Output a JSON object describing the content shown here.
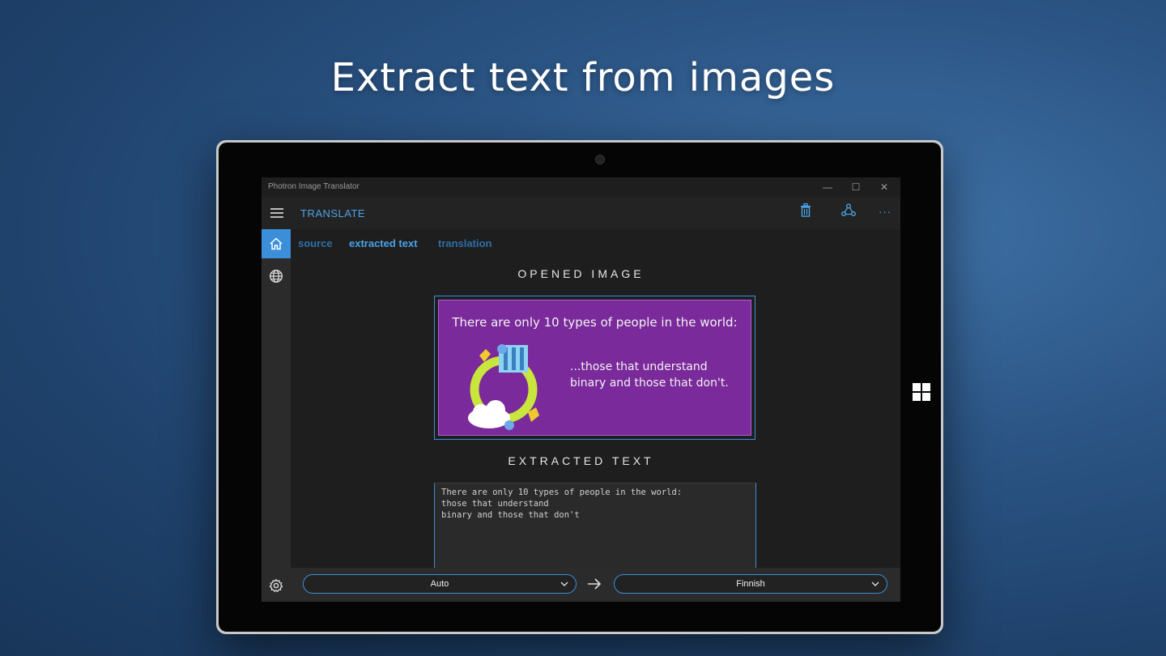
{
  "headline": "Extract text from images",
  "window": {
    "title": "Photron Image Translator",
    "minimize": "—",
    "maximize": "☐",
    "close": "✕"
  },
  "appbar": {
    "title": "TRANSLATE",
    "icons": [
      "hamburger-menu-icon",
      "trash-icon",
      "share-icon",
      "more-icon"
    ],
    "more_label": "···"
  },
  "tabs": [
    {
      "label": "source",
      "active": false
    },
    {
      "label": "extracted text",
      "active": true
    },
    {
      "label": "translation",
      "active": false
    }
  ],
  "sections": {
    "opened_image": "OPENED  IMAGE",
    "extracted_text": "EXTRACTED  TEXT"
  },
  "image_preview": {
    "title": "There are only 10 types of people in the world:",
    "line1": "...those that understand",
    "line2": "binary and those that don't."
  },
  "extracted_text": [
    "There are only 10 types of people in the world:",
    "those that understand",
    "binary and those that don't"
  ],
  "language": {
    "source": "Auto",
    "target": "Finnish"
  },
  "colors": {
    "accent": "#3a8fd8",
    "link": "#4aa3e6",
    "image_bg": "#7a2a9a"
  }
}
